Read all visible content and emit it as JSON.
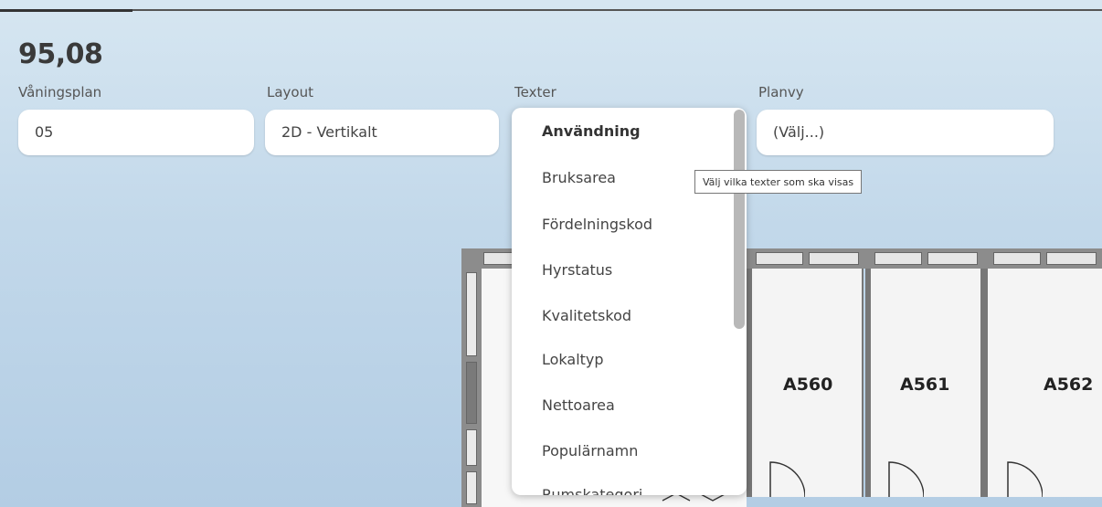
{
  "header": {
    "value": "95,08"
  },
  "fields": [
    {
      "label": "Våningsplan",
      "value": "05"
    },
    {
      "label": "Layout",
      "value": "2D - Vertikalt"
    },
    {
      "label": "Texter",
      "value": "Användning"
    },
    {
      "label": "Planvy",
      "value": "(Välj...)"
    }
  ],
  "texter_dropdown": {
    "items": [
      "Användning",
      "Bruksarea",
      "Fördelningskod",
      "Hyrstatus",
      "Kvalitetskod",
      "Lokaltyp",
      "Nettoarea",
      "Populärnamn",
      "Rumskategori"
    ],
    "selected": "Användning"
  },
  "tooltip": {
    "text": "Välj vilka texter som ska visas"
  },
  "floorplan": {
    "rooms": [
      "A560",
      "A561",
      "A562"
    ]
  }
}
